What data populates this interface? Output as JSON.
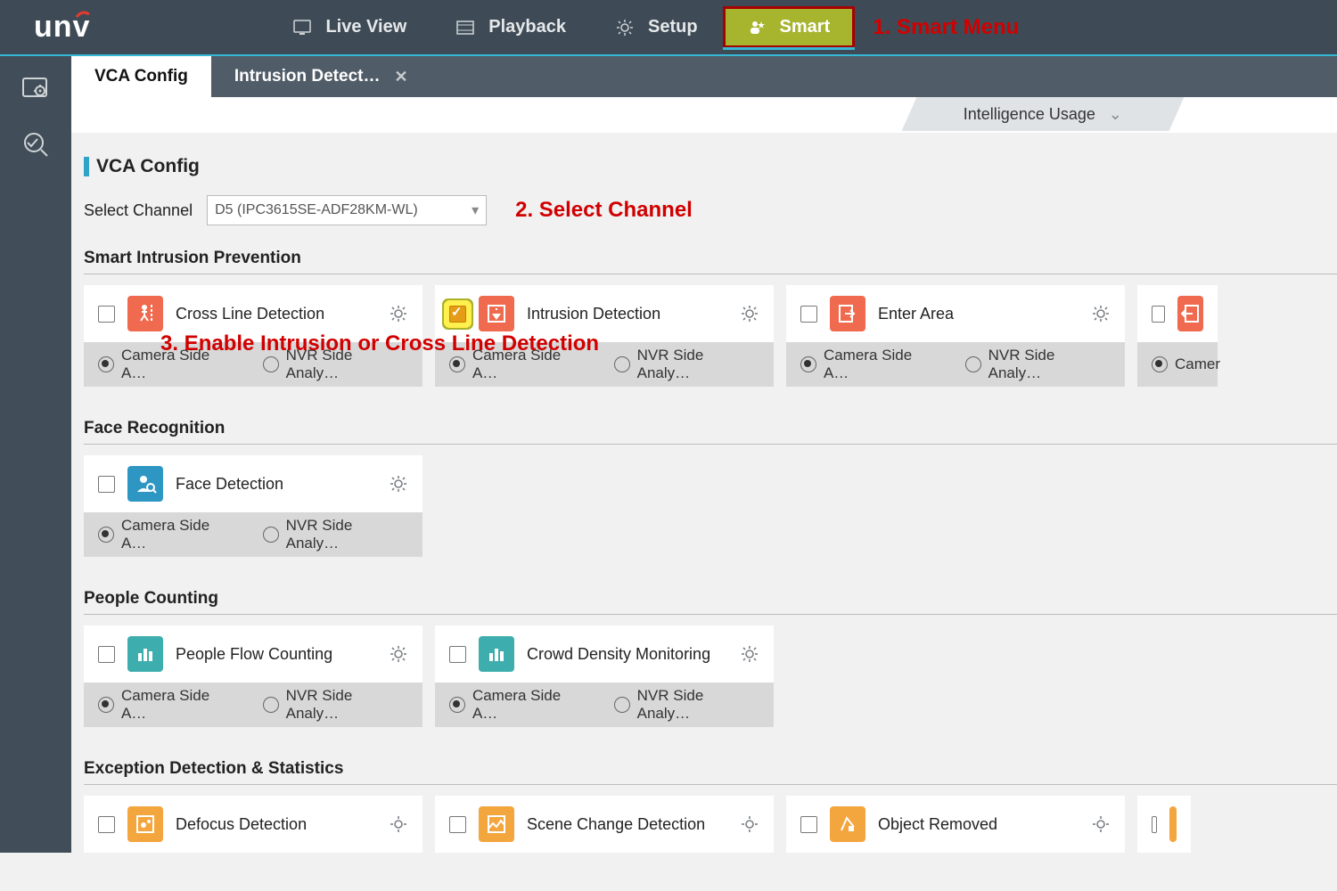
{
  "brand": "unv",
  "topmenu": {
    "live": "Live View",
    "playback": "Playback",
    "setup": "Setup",
    "smart": "Smart"
  },
  "annotations": {
    "a1": "1. Smart Menu",
    "a2": "2. Select Channel",
    "a3": "3. Enable Intrusion or Cross Line Detection"
  },
  "tabs": {
    "t1": "VCA Config",
    "t2": "Intrusion Detect…"
  },
  "intel_usage": "Intelligence Usage",
  "page_title": "VCA Config",
  "select_channel_label": "Select Channel",
  "select_channel_value": "D5 (IPC3615SE-ADF28KM-WL)",
  "sections": {
    "sip": "Smart Intrusion Prevention",
    "face": "Face Recognition",
    "people": "People Counting",
    "exc": "Exception Detection & Statistics"
  },
  "radio": {
    "cam": "Camera Side A…",
    "nvr": "NVR Side Analy…",
    "cam_short": "Camer"
  },
  "cards": {
    "cross_line": "Cross Line Detection",
    "intrusion": "Intrusion Detection",
    "enter_area": "Enter Area",
    "face_detection": "Face Detection",
    "people_flow": "People Flow Counting",
    "crowd": "Crowd Density Monitoring",
    "defocus": "Defocus Detection",
    "scene": "Scene Change Detection",
    "obj_removed": "Object Removed"
  }
}
